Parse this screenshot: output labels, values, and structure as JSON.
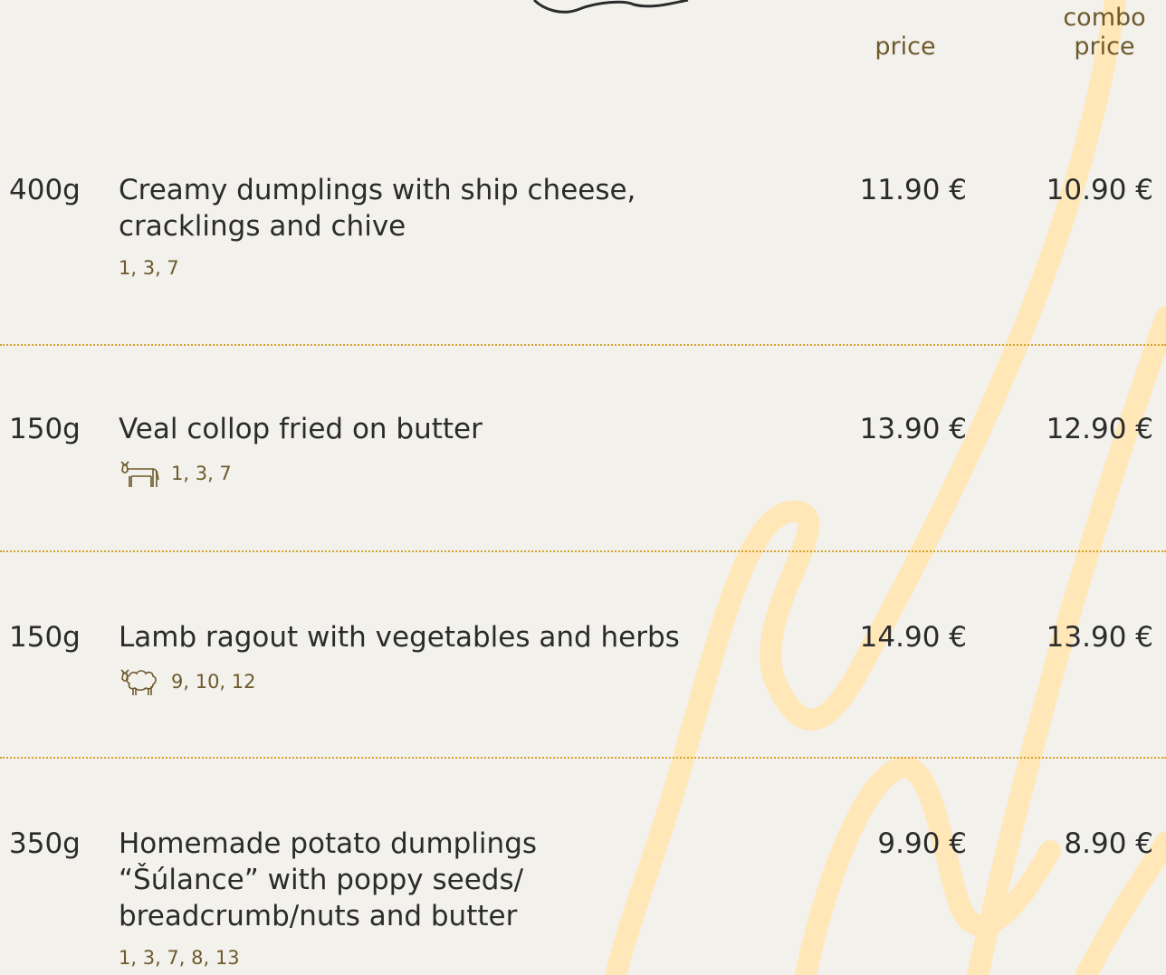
{
  "header": {
    "price_label": "price",
    "combo_label_line1": "combo",
    "combo_label_line2": "price"
  },
  "items": [
    {
      "weight": "400g",
      "name": "Creamy dumplings with ship cheese, cracklings and chive",
      "price": "11.90 €",
      "combo_price": "10.90 €",
      "allergens": "1, 3, 7",
      "icon": null
    },
    {
      "weight": "150g",
      "name": "Veal collop fried on butter",
      "price": "13.90 €",
      "combo_price": "12.90 €",
      "allergens": "1, 3, 7",
      "icon": "cow-icon"
    },
    {
      "weight": "150g",
      "name": "Lamb ragout with vegetables and herbs",
      "price": "14.90 €",
      "combo_price": "13.90 €",
      "allergens": "9, 10, 12",
      "icon": "sheep-icon"
    },
    {
      "weight": "350g",
      "name": "Homemade potato dumplings “Šúlance” with poppy seeds/ breadcrumb/nuts and butter",
      "price": "9.90 €",
      "combo_price": "8.90 €",
      "allergens": "1, 3, 7, 8, 13",
      "icon": null
    }
  ],
  "colors": {
    "background": "#f3f1ec",
    "accent_gold": "#d4a22c",
    "header_brown": "#6e5a2c",
    "decor_yellow": "#ffe7b8"
  }
}
